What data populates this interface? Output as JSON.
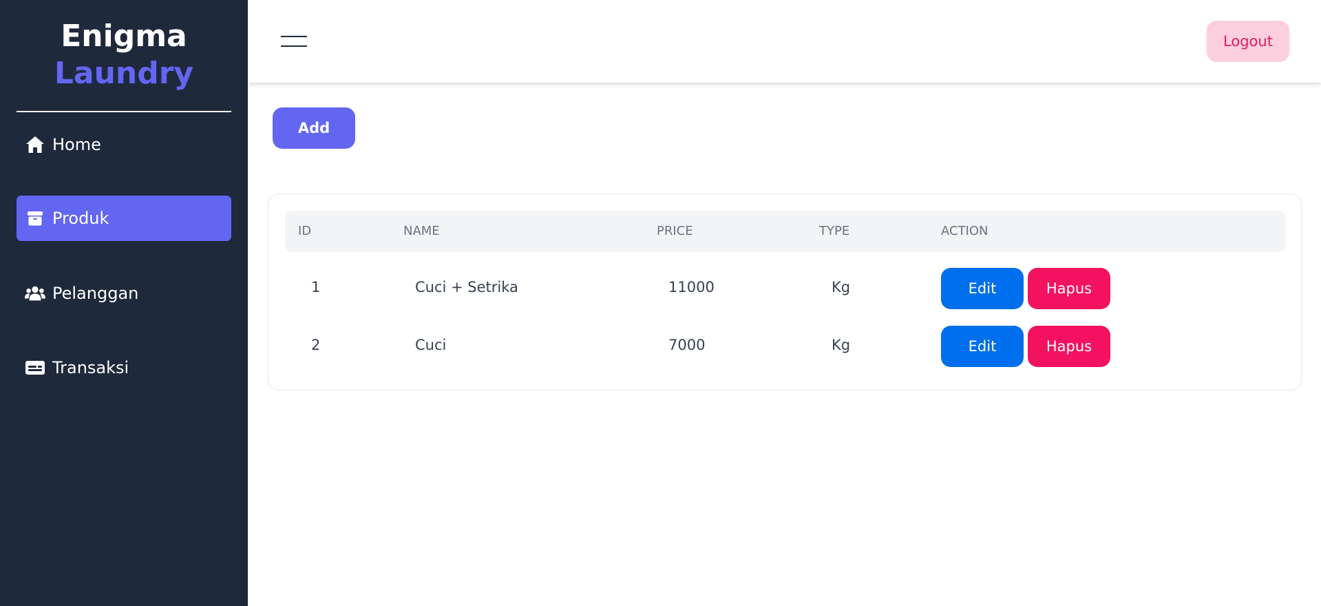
{
  "brand": {
    "line1": "Enigma",
    "line2": "Laundry"
  },
  "colors": {
    "sidebar_bg": "#1e293b",
    "accent": "#6366f1",
    "edit": "#006fee",
    "delete": "#f31260",
    "logout_bg": "#fbcfdd",
    "logout_text": "#e11d63"
  },
  "sidebar": {
    "items": [
      {
        "label": "Home",
        "icon": "home-icon",
        "active": false
      },
      {
        "label": "Produk",
        "icon": "box-icon",
        "active": true
      },
      {
        "label": "Pelanggan",
        "icon": "users-icon",
        "active": false
      },
      {
        "label": "Transaksi",
        "icon": "id-card-icon",
        "active": false
      }
    ]
  },
  "header": {
    "menu_icon": "hamburger-icon",
    "logout_label": "Logout"
  },
  "main": {
    "add_label": "Add",
    "table": {
      "columns": [
        "ID",
        "NAME",
        "PRICE",
        "TYPE",
        "ACTION"
      ],
      "rows": [
        {
          "id": "1",
          "name": "Cuci + Setrika",
          "price": "11000",
          "type": "Kg",
          "edit_label": "Edit",
          "delete_label": "Hapus"
        },
        {
          "id": "2",
          "name": "Cuci",
          "price": "7000",
          "type": "Kg",
          "edit_label": "Edit",
          "delete_label": "Hapus"
        }
      ]
    }
  }
}
